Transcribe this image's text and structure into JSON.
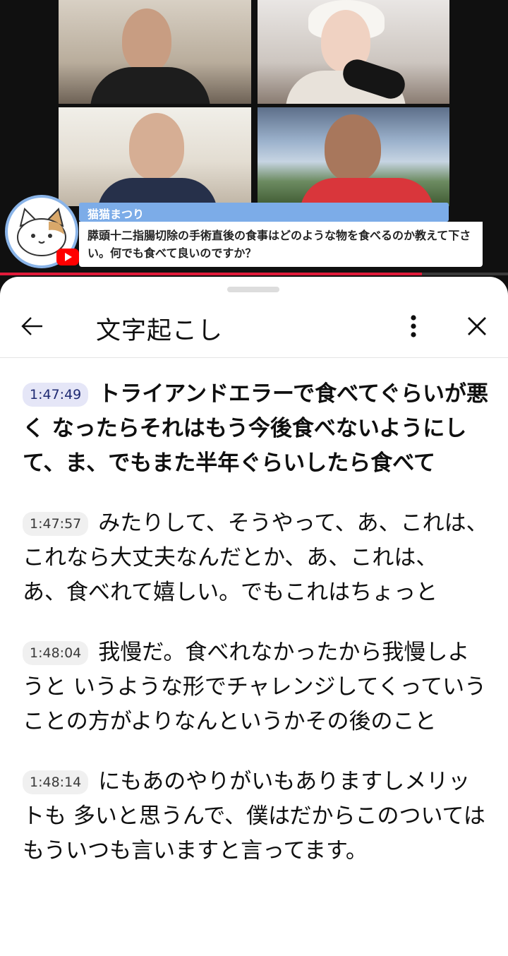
{
  "video": {
    "progress_fraction": 0.83,
    "colors": {
      "progress": "#e01a3a",
      "chat_header": "#7cace8"
    }
  },
  "chat": {
    "author": "猫猫まつり",
    "message": "膵頭十二指腸切除の手術直後の食事はどのような物を食べるのか教えて下さい。何でも食べて良いのですか？",
    "avatar_icon": "cat-avatar-icon",
    "badge_icon": "youtube-icon"
  },
  "panel": {
    "title": "文字起こし",
    "back_icon": "back-arrow-icon",
    "more_icon": "more-vert-icon",
    "close_icon": "close-icon"
  },
  "transcript": [
    {
      "time": "1:47:49",
      "text": "トライアンドエラーで食べてぐらいが悪く なったらそれはもう今後食べないようにし て、ま、でもまた半年ぐらいしたら食べて",
      "active": true
    },
    {
      "time": "1:47:57",
      "text": "みたりして、そうやって、あ、これは、 これなら大丈夫なんだとか、あ、これは、 あ、食べれて嬉しい。でもこれはちょっと",
      "active": false
    },
    {
      "time": "1:48:04",
      "text": "我慢だ。食べれなかったから我慢しようと いうような形でチャレンジしてくっていう ことの方がよりなんというかその後のこと",
      "active": false
    },
    {
      "time": "1:48:14",
      "text": "にもあのやりがいもありますしメリットも 多いと思うんで、僕はだからこのついては もういつも言いますと言ってます。",
      "active": false
    }
  ]
}
